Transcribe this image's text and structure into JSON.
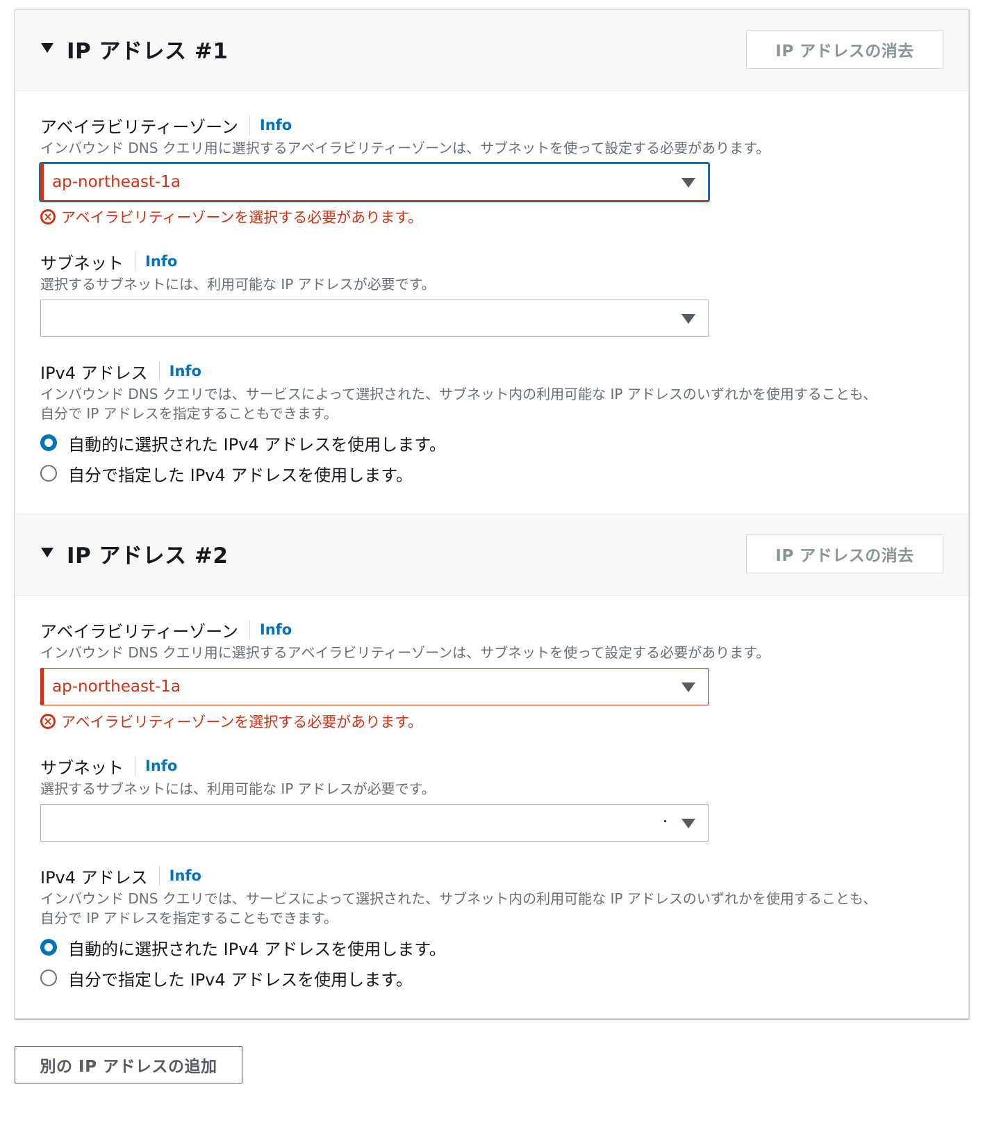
{
  "sections": [
    {
      "title": "IP アドレス #1",
      "remove_label": "IP アドレスの消去",
      "az": {
        "label": "アベイラビリティーゾーン",
        "info": "Info",
        "desc": "インバウンド DNS クエリ用に選択するアベイラビリティーゾーンは、サブネットを使って設定する必要があります。",
        "value": "ap-northeast-1a",
        "error": "アベイラビリティーゾーンを選択する必要があります。"
      },
      "subnet": {
        "label": "サブネット",
        "info": "Info",
        "desc": "選択するサブネットには、利用可能な IP アドレスが必要です。"
      },
      "ipv4": {
        "label": "IPv4 アドレス",
        "info": "Info",
        "desc_line1": "インバウンド DNS クエリでは、サービスによって選択された、サブネット内の利用可能な IP アドレスのいずれかを使用することも、",
        "desc_line2": "自分で IP アドレスを指定することもできます。",
        "option_auto": "自動的に選択された IPv4 アドレスを使用します。",
        "option_manual": "自分で指定した IPv4 アドレスを使用します。"
      }
    },
    {
      "title": "IP アドレス #2",
      "remove_label": "IP アドレスの消去",
      "az": {
        "label": "アベイラビリティーゾーン",
        "info": "Info",
        "desc": "インバウンド DNS クエリ用に選択するアベイラビリティーゾーンは、サブネットを使って設定する必要があります。",
        "value": "ap-northeast-1a",
        "error": "アベイラビリティーゾーンを選択する必要があります。"
      },
      "subnet": {
        "label": "サブネット",
        "info": "Info",
        "desc": "選択するサブネットには、利用可能な IP アドレスが必要です。"
      },
      "ipv4": {
        "label": "IPv4 アドレス",
        "info": "Info",
        "desc_line1": "インバウンド DNS クエリでは、サービスによって選択された、サブネット内の利用可能な IP アドレスのいずれかを使用することも、",
        "desc_line2": "自分で IP アドレスを指定することもできます。",
        "option_auto": "自動的に選択された IPv4 アドレスを使用します。",
        "option_manual": "自分で指定した IPv4 アドレスを使用します。"
      }
    }
  ],
  "add_button_label": "別の IP アドレスの追加",
  "colors": {
    "error": "#d13212",
    "link": "#0073bb",
    "muted": "#687078"
  }
}
